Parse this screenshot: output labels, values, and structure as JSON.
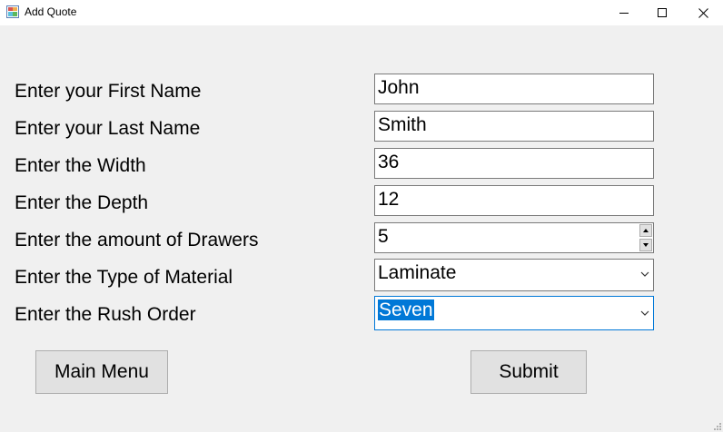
{
  "window": {
    "title": "Add Quote",
    "icon": "app-form-icon",
    "controls": [
      "minimize-icon",
      "maximize-icon",
      "close-icon"
    ]
  },
  "form": {
    "first_name": {
      "label": "Enter your First Name",
      "value": "John"
    },
    "last_name": {
      "label": "Enter your Last Name",
      "value": "Smith"
    },
    "width": {
      "label": "Enter the Width",
      "value": "36"
    },
    "depth": {
      "label": "Enter the Depth",
      "value": "12"
    },
    "drawers": {
      "label": "Enter the amount of Drawers",
      "value": "5"
    },
    "material": {
      "label": "Enter the Type of Material",
      "value": "Laminate"
    },
    "rush_order": {
      "label": "Enter the Rush Order",
      "value": "Seven"
    }
  },
  "buttons": {
    "main_menu": "Main Menu",
    "submit": "Submit"
  },
  "colors": {
    "background": "#f0f0f0",
    "selection": "#0078d7",
    "field_border": "#7a7a7a",
    "button_face": "#e1e1e1"
  }
}
